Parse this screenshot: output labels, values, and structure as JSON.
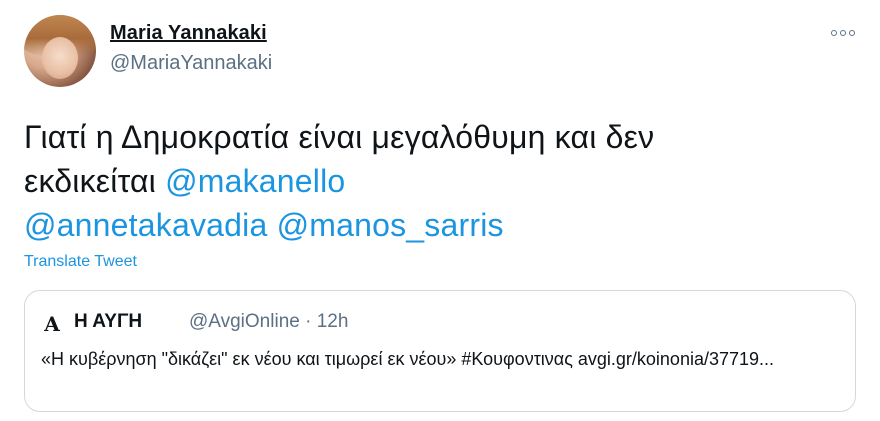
{
  "author": {
    "display_name": "Maria Yannakaki",
    "handle": "@MariaYannakaki"
  },
  "tweet": {
    "text_part1": "Γιατί η Δημοκρατία είναι μεγαλόθυμη και δεν",
    "text_part2": "εκδικείται ",
    "mentions": [
      "@makanello",
      "@annetakavadia",
      "@manos_sarris"
    ],
    "translate_label": "Translate Tweet"
  },
  "quoted_tweet": {
    "logo_glyph": "A",
    "display_name": "Η ΑΥΓΗ",
    "meta": "@AvgiOnline · 12h",
    "text": "«Η κυβέρνηση \"δικάζει\" εκ νέου και τιμωρεί εκ νέου» #Κουφοντινας avgi.gr/koinonia/37719..."
  },
  "icons": {
    "more": "more-options-icon",
    "avatar": "avatar"
  }
}
